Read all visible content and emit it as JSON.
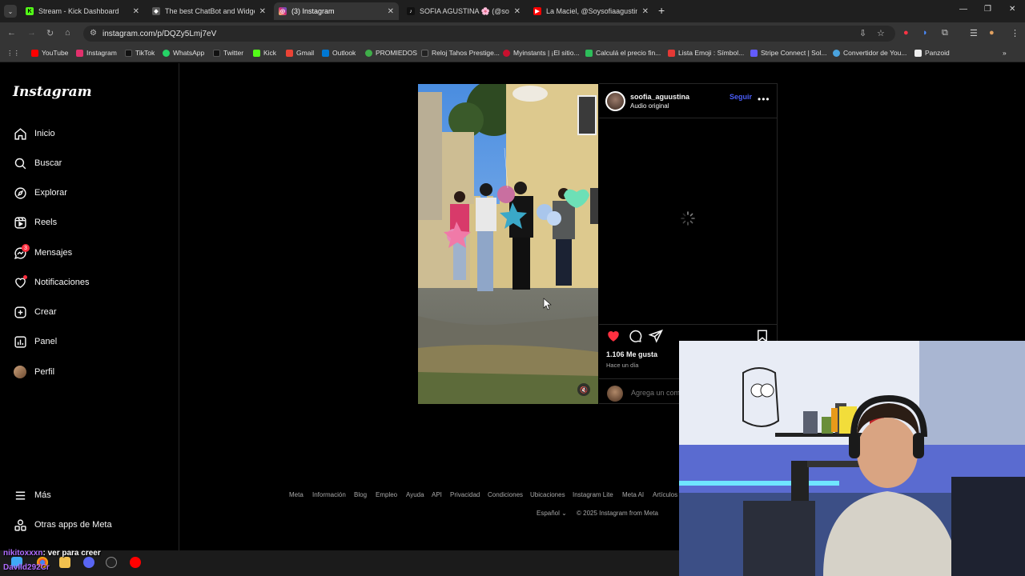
{
  "browser": {
    "tabs": [
      {
        "label": "Stream - Kick Dashboard",
        "icon": "kick-icon",
        "color": "#53fc18"
      },
      {
        "label": "The best ChatBot and Widgets",
        "icon": "botrix-icon",
        "color": "#5a5a5a"
      },
      {
        "label": "(3) Instagram",
        "icon": "instagram-icon",
        "color": "#e1306c",
        "active": true
      },
      {
        "label": "SOFIA AGUSTINA 🌸 (@sofiaag",
        "icon": "tiktok-icon",
        "color": "#111111"
      },
      {
        "label": "La Maciel, @Soysofiaagustina -",
        "icon": "youtube-icon",
        "color": "#ff0000"
      }
    ],
    "url": "instagram.com/p/DQZy5Lmj7eV",
    "bookmarks": [
      {
        "label": "YouTube",
        "color": "#ff0000"
      },
      {
        "label": "Instagram",
        "color": "#e1306c"
      },
      {
        "label": "TikTok",
        "color": "#111111"
      },
      {
        "label": "WhatsApp",
        "color": "#25d366"
      },
      {
        "label": "Twitter",
        "color": "#111111"
      },
      {
        "label": "Kick",
        "color": "#53fc18"
      },
      {
        "label": "Gmail",
        "color": "#ea4335"
      },
      {
        "label": "Outlook",
        "color": "#0078d4"
      },
      {
        "label": "PROMIEDOS",
        "color": "#3fae49"
      },
      {
        "label": "Reloj Tahos Prestige...",
        "color": "#222222"
      },
      {
        "label": "Myinstants | ¡El sitio...",
        "color": "#c8102e"
      },
      {
        "label": "Calculá el precio fin...",
        "color": "#2dbd5a"
      },
      {
        "label": "Lista Emoji : Símbol...",
        "color": "#e53935"
      },
      {
        "label": "Stripe Connect | Sol...",
        "color": "#635bff"
      },
      {
        "label": "Convertidor de You...",
        "color": "#4aa3df"
      },
      {
        "label": "Panzoid",
        "color": "#eeeeee"
      }
    ]
  },
  "instagram": {
    "logo": "Instagram",
    "nav": [
      {
        "label": "Inicio",
        "icon": "home-icon"
      },
      {
        "label": "Buscar",
        "icon": "search-icon"
      },
      {
        "label": "Explorar",
        "icon": "compass-icon"
      },
      {
        "label": "Reels",
        "icon": "reels-icon"
      },
      {
        "label": "Mensajes",
        "icon": "messenger-icon",
        "badge": "3"
      },
      {
        "label": "Notificaciones",
        "icon": "heart-icon",
        "dot": true
      },
      {
        "label": "Crear",
        "icon": "plus-square-icon"
      },
      {
        "label": "Panel",
        "icon": "dashboard-icon"
      },
      {
        "label": "Perfil",
        "icon": "profile-avatar"
      }
    ],
    "more": {
      "label": "Más",
      "icon": "hamburger-icon"
    },
    "meta_apps": {
      "label": "Otras apps de Meta",
      "icon": "meta-apps-icon"
    },
    "post": {
      "username": "soofia_aguustina",
      "audio": "Audio original",
      "follow": "Seguir",
      "likes": "1.106 Me gusta",
      "time": "Hace un día",
      "comment_placeholder": "Agrega un comentario..."
    },
    "footer": {
      "links": [
        "Meta",
        "Información",
        "Blog",
        "Empleo",
        "Ayuda",
        "API",
        "Privacidad",
        "Condiciones",
        "Ubicaciones",
        "Instagram Lite",
        "Meta AI",
        "Artículos"
      ],
      "language": "Español",
      "copyright": "© 2025 Instagram from Meta"
    }
  },
  "overlay": {
    "chat_user": "nikitoxxxn",
    "chat_message": ": ver para creer",
    "chat_user2": "Davlld292Cr"
  }
}
